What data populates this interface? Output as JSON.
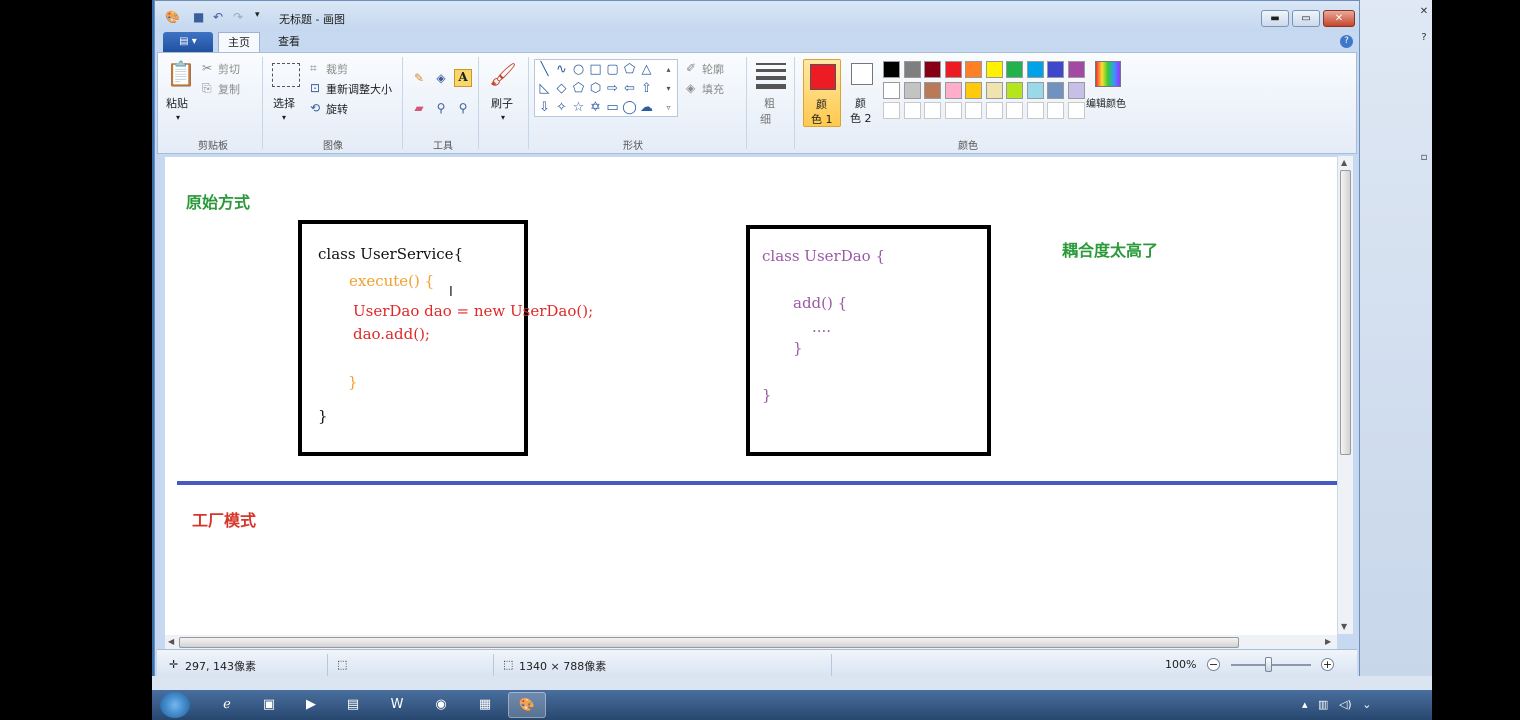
{
  "window": {
    "title": "无标题 - 画图"
  },
  "tabs": {
    "menu": "▤ ▾",
    "home": "主页",
    "view": "查看"
  },
  "ribbon": {
    "clipboard": {
      "paste": "粘贴",
      "cut": "剪切",
      "copy": "复制",
      "label": "剪贴板"
    },
    "image": {
      "select": "选择",
      "crop": "裁剪",
      "resize": "重新调整大小",
      "rotate": "旋转",
      "label": "图像"
    },
    "tools": {
      "label": "工具"
    },
    "brushes": {
      "label": "刷子"
    },
    "shapes": {
      "outline": "轮廓",
      "fill": "填充",
      "label": "形状"
    },
    "size": {
      "label_top": "粗",
      "label_bottom": "细"
    },
    "colors": {
      "color1_top": "颜",
      "color1_bottom": "色 1",
      "color2_top": "颜",
      "color2_bottom": "色 2",
      "edit": "编辑颜色",
      "label": "颜色",
      "palette_row1": [
        "#000000",
        "#7f7f7f",
        "#880015",
        "#ed1c24",
        "#ff7f27",
        "#fff200",
        "#22b14c",
        "#00a2e8",
        "#3f48cc",
        "#a349a4"
      ],
      "palette_row2": [
        "#ffffff",
        "#c3c3c3",
        "#b97a57",
        "#ffaec9",
        "#ffc90e",
        "#efe4b0",
        "#b5e61d",
        "#99d9ea",
        "#7092be",
        "#c8bfe7"
      ]
    }
  },
  "canvas": {
    "heading_original": "原始方式",
    "coupling_note": "耦合度太高了",
    "heading_factory": "工厂模式",
    "service_code": {
      "line1": "class UserService{",
      "line2": "execute() {",
      "line3": "UserDao dao = new UserDao();",
      "line4": "dao.add();",
      "line5": "}",
      "line6": "}"
    },
    "dao_code": {
      "line1": "class UserDao {",
      "line2": "add() {",
      "line3": "....",
      "line4": "}",
      "line5": "}"
    }
  },
  "status": {
    "cursor_pos": "297, 143像素",
    "canvas_size": "1340 × 788像素",
    "zoom": "100%"
  },
  "colors": {
    "heading_green": "#2a9a3a",
    "heading_red": "#d8352a",
    "code_orange": "#f0a030",
    "code_red": "#e02828",
    "code_purple": "#9b59a6",
    "divider_blue": "#4659c4"
  }
}
